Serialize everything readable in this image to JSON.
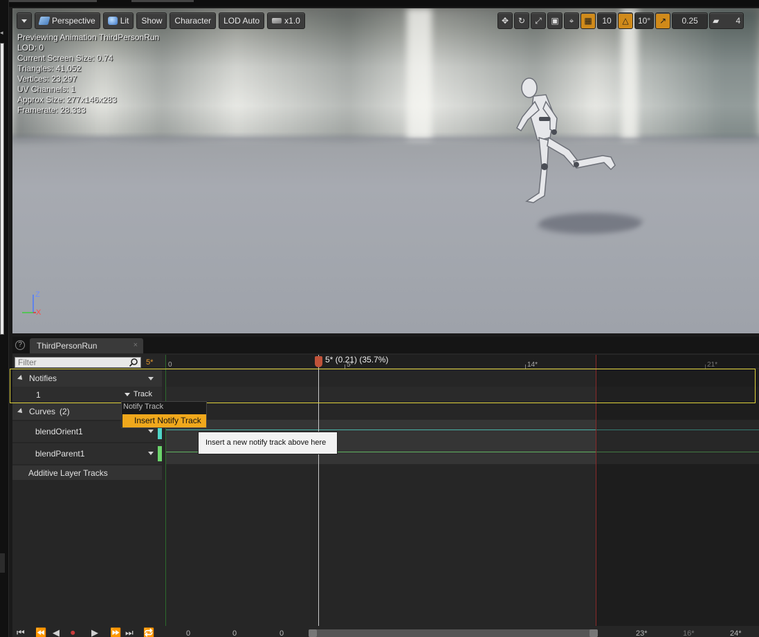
{
  "viewport": {
    "toolbar": {
      "menu_label": "",
      "perspective_label": "Perspective",
      "lit_label": "Lit",
      "show_label": "Show",
      "character_label": "Character",
      "lod_label": "LOD Auto",
      "speed_label": "x1.0",
      "grid_value": "10",
      "rotation_value": "10°",
      "scale_value": "0.25",
      "camera_speed": "4"
    },
    "stats": [
      "Previewing Animation ThirdPersonRun",
      "LOD: 0",
      "Current Screen Size: 0.74",
      "Triangles: 41,052",
      "Vertices: 23,297",
      "UV Channels: 1",
      "Approx Size: 277x146x283",
      "Framerate: 28.333"
    ],
    "axis": {
      "z": "Z",
      "x": "X"
    }
  },
  "panel": {
    "tab_label": "ThirdPersonRun",
    "help": "?",
    "close": "×",
    "filter_placeholder": "Filter",
    "current_frame": "5*",
    "notifies_label": "Notifies",
    "notify_track_index": "1",
    "track_button": "Track",
    "curves_label": "Curves",
    "curves_count": "(2)",
    "curves": [
      {
        "name": "blendOrient1",
        "color": "#4fd6c8"
      },
      {
        "name": "blendParent1",
        "color": "#6bd46b"
      }
    ],
    "additive_label": "Additive Layer Tracks"
  },
  "timeline": {
    "ticks": [
      "0",
      "5*",
      "14*",
      "21*"
    ],
    "scrub_label": "5* (0.21) (35.7%)"
  },
  "context_menu": {
    "header": "Notify Track",
    "item": "Insert Notify Track",
    "tooltip": "Insert a new notify track above here"
  },
  "transport": {
    "values": [
      "0",
      "0",
      "0"
    ],
    "right_values": [
      "23*",
      "16*",
      "24*"
    ]
  },
  "colors": {
    "accent": "#f0a81c",
    "frame": "#e89a2e",
    "selection_outline": "#e0d23a",
    "end_marker": "#8a2a2a"
  }
}
